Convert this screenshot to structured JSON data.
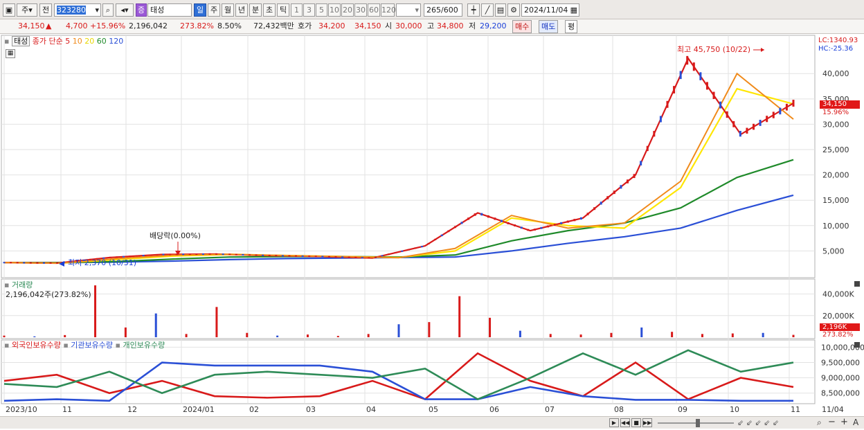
{
  "toolbar": {
    "type_label": "주",
    "prev_label": "전",
    "code": "323280",
    "stock_badge": "증",
    "stock_name": "태성",
    "periods": [
      "일",
      "주",
      "월",
      "년",
      "분",
      "초",
      "틱"
    ],
    "active_period": "일",
    "intervals": [
      "1",
      "3",
      "5",
      "10",
      "20",
      "30",
      "60",
      "120"
    ],
    "count": "265",
    "total": "/600",
    "date": "2024/11/04"
  },
  "info": {
    "price": "34,150",
    "arrow": "▲",
    "change": "4,700",
    "change_pct": "+15.96%",
    "volume": "2,196,042",
    "vol_ratio": "273.82%",
    "turnover": "8.50%",
    "amount": "72,432백만",
    "quote_label": "호가",
    "bid1": "34,200",
    "bid2": "34,150",
    "open_label": "시",
    "open": "30,000",
    "high_label": "고",
    "high": "34,800",
    "low_label": "저",
    "low": "29,200",
    "buy_label": "매수",
    "sell_label": "매도",
    "avg_label": "평"
  },
  "price_panel": {
    "name": "태성",
    "ma_label": "종가 단순",
    "ma_periods": [
      "5",
      "10",
      "20",
      "60",
      "120"
    ],
    "ma_colors": [
      "#d81a1a",
      "#f08a1a",
      "#e8d800",
      "#1f8a2a",
      "#2a4fd6"
    ],
    "lc": "LC:1340.93",
    "hc": "HC:-25.36",
    "current_tag": "34,150",
    "current_pct": "15.96%",
    "high_annotation": "최고 45,750 (10/22)",
    "low_annotation": "최저 2,370 (10/31)",
    "dividend_annotation": "배당락(0.00%)"
  },
  "volume_panel": {
    "title": "거래량",
    "value_text": "2,196,042주(273.82%)",
    "current_tag": "2,196K",
    "current_pct": "273.82%"
  },
  "holdings_panel": {
    "legend": [
      "외국인보유수량",
      "기관보유수량",
      "개인보유수량"
    ],
    "colors": [
      "#d81a1a",
      "#2a4fd6",
      "#2e8b57"
    ]
  },
  "x_axis_labels": [
    "2023/10",
    "11",
    "12",
    "2024/01",
    "02",
    "03",
    "04",
    "05",
    "06",
    "07",
    "08",
    "09",
    "10",
    "11",
    "11/04"
  ],
  "chart_data": [
    {
      "type": "line",
      "title": "태성",
      "y_ticks": [
        "40,000",
        "35,000",
        "30,000",
        "25,000",
        "20,000",
        "15,000",
        "10,000",
        "5,000"
      ],
      "ylim": [
        0,
        47000
      ],
      "x": [
        "2023/10",
        "11",
        "12",
        "2024/01",
        "02",
        "03",
        "04",
        "05",
        "06",
        "07",
        "08",
        "09",
        "10",
        "11"
      ],
      "series": [
        {
          "name": "5",
          "values": [
            2700,
            2600,
            3700,
            4300,
            4400,
            4100,
            3900,
            3600,
            6000,
            12500,
            9000,
            11500,
            20000,
            43000,
            28000,
            34150
          ]
        },
        {
          "name": "20",
          "values": [
            2700,
            2600,
            3300,
            4000,
            4300,
            4100,
            3900,
            3700,
            5000,
            11500,
            10000,
            9500,
            17500,
            37000,
            34000
          ]
        },
        {
          "name": "60",
          "values": [
            2700,
            2700,
            2900,
            3400,
            3800,
            3900,
            3900,
            3800,
            4200,
            7000,
            9000,
            10500,
            13500,
            19500,
            23000
          ]
        },
        {
          "name": "120",
          "values": [
            2700,
            2700,
            2800,
            3000,
            3300,
            3500,
            3600,
            3700,
            3800,
            5000,
            6500,
            7800,
            9500,
            13000,
            16000
          ]
        }
      ]
    },
    {
      "type": "bar",
      "title": "거래량",
      "y_ticks": [
        "40,000K",
        "20,000K"
      ],
      "ylim": [
        0,
        50000
      ],
      "values": [
        1500,
        800,
        2000,
        48000,
        9000,
        22000,
        3000,
        28000,
        4000,
        1500,
        2500,
        1200,
        3000,
        12000,
        14000,
        38000,
        18000,
        6000,
        3000,
        2500,
        4000,
        9000,
        5000,
        3000,
        3500,
        4000,
        2196
      ]
    },
    {
      "type": "line",
      "title": "보유수량",
      "y_ticks": [
        "10,000,000",
        "9,500,000",
        "9,000,000",
        "8,500,000"
      ],
      "ylim": [
        8200000,
        10100000
      ],
      "series": [
        {
          "name": "외국인보유수량",
          "values": [
            8900000,
            9100000,
            8500000,
            8900000,
            8400000,
            8350000,
            8400000,
            8900000,
            8300000,
            9800000,
            8900000,
            8400000,
            9500000,
            8300000,
            9000000,
            8700000
          ]
        },
        {
          "name": "기관보유수량",
          "values": [
            8250000,
            8300000,
            8250000,
            9500000,
            9400000,
            9400000,
            9400000,
            9200000,
            8300000,
            8300000,
            8700000,
            8400000,
            8280000,
            8280000,
            8250000,
            8250000
          ]
        },
        {
          "name": "개인보유수량",
          "values": [
            8800000,
            8700000,
            9200000,
            8500000,
            9100000,
            9200000,
            9100000,
            9000000,
            9300000,
            8300000,
            9000000,
            9800000,
            9100000,
            9900000,
            9200000,
            9500000
          ]
        }
      ]
    }
  ]
}
